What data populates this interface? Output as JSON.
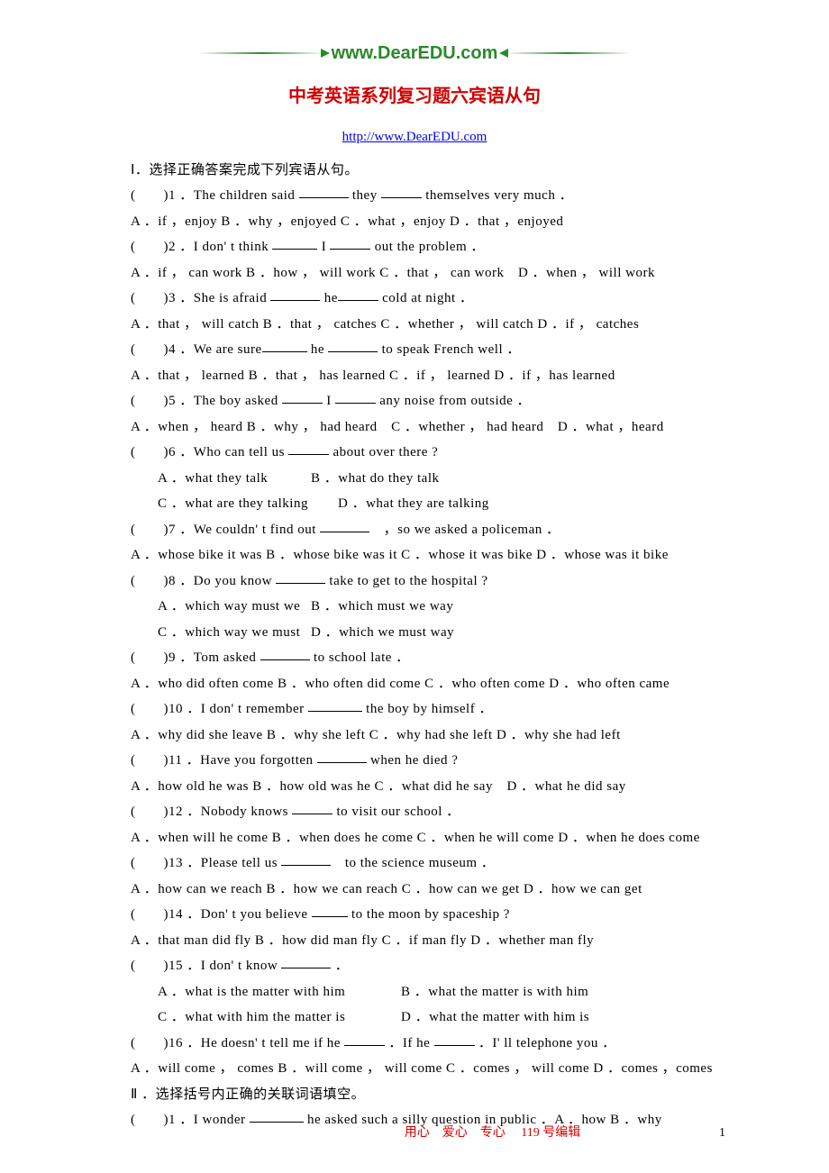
{
  "logo": "www.DearEDU.com",
  "title": "中考英语系列复习题六宾语从句",
  "url": "http://www.DearEDU.com",
  "section1_header": "Ⅰ．选择正确答案完成下列宾语从句。",
  "q1": {
    "stem_a": "(　　)1 ．The children said ",
    "stem_b": " they ",
    "stem_c": " themselves very much ．",
    "opts": "A ．if ，enjoy B ．why ，enjoyed C ．what ，enjoy D ．that ，enjoyed"
  },
  "q2": {
    "stem_a": "(　　)2 ．I don' t think ",
    "stem_b": " I ",
    "stem_c": " out the problem ．",
    "opts": "A ．if ， can work B ．how ， will work C ．that ， can work　D ．when ， will work"
  },
  "q3": {
    "stem_a": "(　　)3 ．She is afraid ",
    "stem_b": " he",
    "stem_c": " cold at night ．",
    "opts": "A ．that ， will catch B ．that ， catches C ．whether ， will catch D ．if ， catches"
  },
  "q4": {
    "stem_a": "(　　)4 ．We are sure",
    "stem_b": " he ",
    "stem_c": " to speak French well ．",
    "opts": "A ．that ， learned B ．that ， has learned C ．if ， learned D ．if ，has learned"
  },
  "q5": {
    "stem_a": "(　　)5 ．The boy asked ",
    "stem_b": " I ",
    "stem_c": " any noise from outside ．",
    "opts": "A ．when ， heard B ．why ， had heard　C ．whether ， had heard　D ．what ，heard"
  },
  "q6": {
    "stem_a": "(　　)6 ．Who can tell us ",
    "stem_b": " about over there ?",
    "optA": "A ．what they talk",
    "optB": "B ．what do they talk",
    "optC": "C ．what are they talking",
    "optD": "D ．what they are talking"
  },
  "q7": {
    "stem_a": "(　　)7 ．We couldn' t find out ",
    "stem_b": "　，so we asked a policeman ．",
    "opts": "A ．whose bike it was B ．whose bike was it C ．whose it was bike D ．whose was it bike"
  },
  "q8": {
    "stem_a": "(　　)8 ．Do you know ",
    "stem_b": " take to get to the hospital ?",
    "optA": "A ．which way must we",
    "optB": "B ．which must we way",
    "optC": "C ．which way we must",
    "optD": "D ．which we must way"
  },
  "q9": {
    "stem_a": "(　　)9 ．Tom asked ",
    "stem_b": " to school late ．",
    "opts": "A ．who did often come B ．who often did come C ．who often come D ．who often came"
  },
  "q10": {
    "stem_a": "(　　)10 ．I don' t remember ",
    "stem_b": " the boy by himself ．",
    "opts": "A ．why did she leave B ．why she left C ．why had she left D ．why she had left"
  },
  "q11": {
    "stem_a": "(　　)11 ．Have you forgotten ",
    "stem_b": " when he died ?",
    "opts": "A ．how old he was B ．how old was he C ．what did he say　D ．what he did say"
  },
  "q12": {
    "stem_a": "(　　)12 ．Nobody knows ",
    "stem_b": " to visit our school ．",
    "opts": "A ．when will he come B ．when does he come C ．when he will come D ．when he does come"
  },
  "q13": {
    "stem_a": "(　　)13 ．Please tell us ",
    "stem_b": "　to the science museum ．",
    "opts": "A ．how can we reach B ．how we can reach C ．how can we get D ．how we can get"
  },
  "q14": {
    "stem_a": "(　　)14 ．Don' t you believe ",
    "stem_b": " to the moon by spaceship ?",
    "opts": "A ．that man did fly B ．how did man fly C ．if man fly D ．whether man fly"
  },
  "q15": {
    "stem_a": "(　　)15 ．I don' t know ",
    "stem_b": " ．",
    "optA": "A ．what is the matter with him",
    "optB": "B ．what the matter is with him",
    "optC": "C ．what with him the matter is",
    "optD": "D ．what the matter with him is"
  },
  "q16": {
    "stem_a": "(　　)16 ．He doesn' t tell me if he ",
    "stem_b": " ．If he ",
    "stem_c": " ．I' ll telephone you ．",
    "opts": "A ．will come ， comes B ．will come ， will come C ．comes ， will come D ．comes ，comes"
  },
  "section2_header": "Ⅱ ．选择括号内正确的关联词语填空。",
  "s2q1": {
    "stem_a": "(　　)1 ．I wonder ",
    "stem_b": " he asked such a silly question in public ．A ．how B ．why"
  },
  "footer_center": "用心　爱心　专心　 119 号编辑",
  "footer_page": "1"
}
